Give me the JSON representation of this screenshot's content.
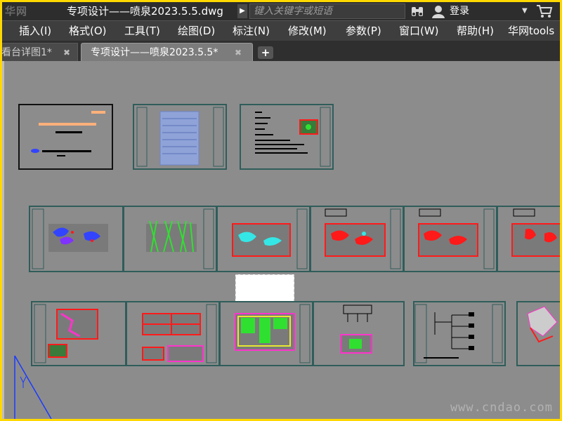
{
  "app": {
    "logo_text": "华网",
    "doc_title": "专项设计——喷泉2023.5.5.dwg",
    "search_placeholder": "键入关键字或短语",
    "login_label": "登录"
  },
  "menu": [
    "插入(I)",
    "格式(O)",
    "工具(T)",
    "绘图(D)",
    "标注(N)",
    "修改(M)",
    "参数(P)",
    "窗口(W)",
    "帮助(H)",
    "华网tools"
  ],
  "tabs": [
    {
      "label": "看台详图1*",
      "active": false
    },
    {
      "label": "专项设计——喷泉2023.5.5*",
      "active": true
    }
  ],
  "colors": {
    "titlebar": "#2d2d2d",
    "menubar": "#3e3e3e",
    "canvas": "#8c8c8c",
    "sheet_border": "#2f5d5a",
    "fountain_red": "#ff1a1a",
    "fountain_cyan": "#35e6e6",
    "fountain_green": "#30e030",
    "outer_frame": "#ffd800"
  },
  "icons": {
    "search": "binoculars-icon",
    "user": "user-icon",
    "cart": "cart-icon",
    "tab_add": "plus-icon"
  },
  "watermark": "www.cndao.com"
}
